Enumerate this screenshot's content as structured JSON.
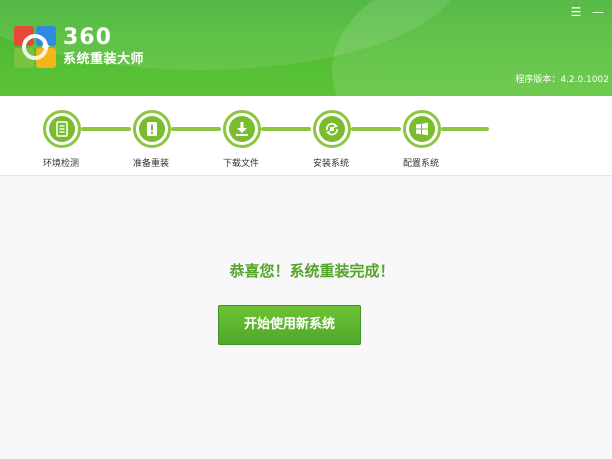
{
  "header": {
    "brand_number": "360",
    "brand_name": "系统重装大师",
    "version": "程序版本：4.2.0.1002",
    "menu_glyph": "☰",
    "minimize_glyph": "—"
  },
  "steps": [
    {
      "label": "环境检测",
      "icon": "document-check-icon"
    },
    {
      "label": "准备重装",
      "icon": "prepare-icon"
    },
    {
      "label": "下载文件",
      "icon": "download-icon"
    },
    {
      "label": "安装系统",
      "icon": "recycle-install-icon"
    },
    {
      "label": "配置系统",
      "icon": "windows-icon"
    }
  ],
  "main": {
    "congrats_text": "恭喜您！系统重装完成！",
    "start_button_label": "开始使用新系统"
  },
  "colors": {
    "brand_green": "#4fbb34",
    "step_green": "#8cc63f",
    "text_green": "#56a52b"
  }
}
